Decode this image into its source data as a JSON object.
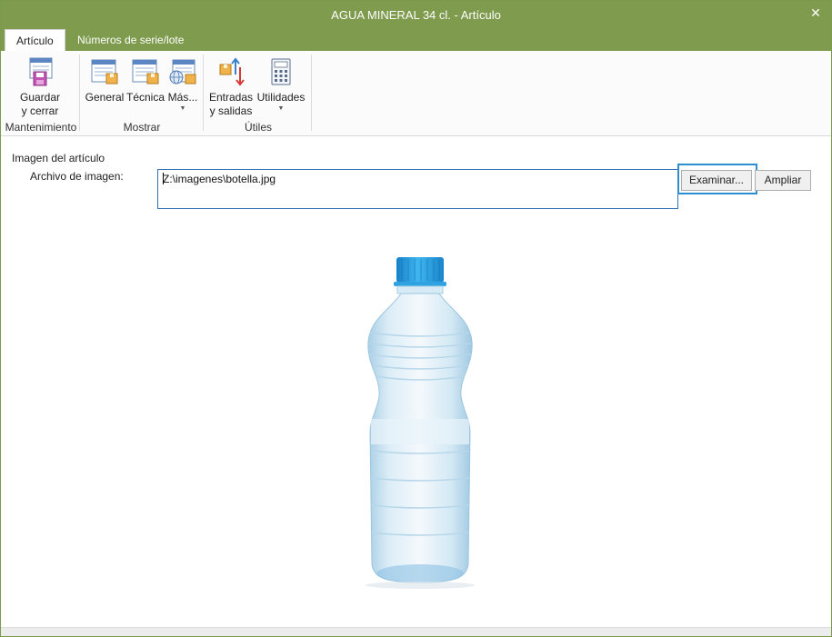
{
  "window": {
    "title": "AGUA MINERAL 34 cl. - Artículo",
    "close_glyph": "✕"
  },
  "tabs": [
    {
      "label": "Artículo",
      "active": true
    },
    {
      "label": "Números de serie/lote",
      "active": false
    }
  ],
  "ribbon": {
    "groups": [
      {
        "label": "Mantenimiento"
      },
      {
        "label": "Mostrar"
      },
      {
        "label": "Útiles"
      }
    ],
    "buttons": {
      "save": {
        "line1": "Guardar",
        "line2": "y cerrar",
        "icon": "save-document-icon"
      },
      "general": {
        "label": "General",
        "icon": "general-view-icon"
      },
      "tecnica": {
        "label": "Técnica",
        "icon": "technical-view-icon"
      },
      "mas": {
        "label": "Más...",
        "icon": "more-views-icon"
      },
      "entradas": {
        "line1": "Entradas",
        "line2": "y salidas",
        "icon": "stock-in-out-icon"
      },
      "utilidades": {
        "label": "Utilidades",
        "icon": "calculator-icon"
      }
    }
  },
  "content": {
    "section_title": "Imagen del artículo",
    "file_label": "Archivo de imagen:",
    "file_value": "Z:\\imagenes\\botella.jpg",
    "browse_label": "Examinar...",
    "zoom_label": "Ampliar"
  },
  "colors": {
    "title_bar": "#7e9b4e",
    "focus": "#2e8fd0",
    "bottle_cap": "#1e9ee0"
  }
}
